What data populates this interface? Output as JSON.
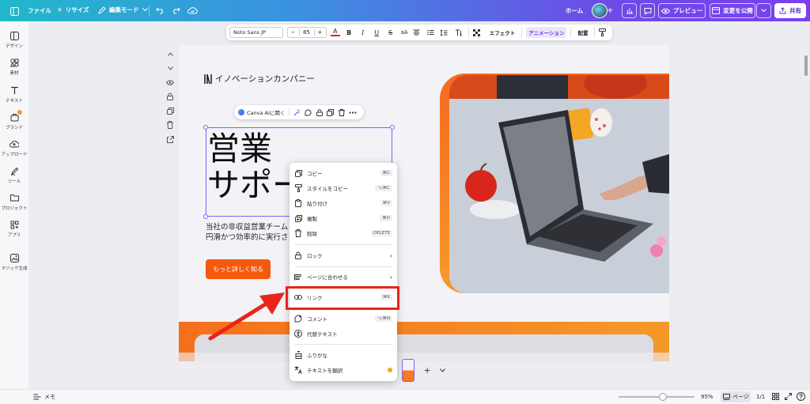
{
  "topbar": {
    "file": "ファイル",
    "resize": "リサイズ",
    "edit_mode": "編集モード",
    "home": "ホーム",
    "preview": "プレビュー",
    "publish": "変更を公開",
    "share": "共有"
  },
  "sidebar": {
    "items": [
      {
        "label": "デザイン",
        "icon": "layout-icon"
      },
      {
        "label": "素材",
        "icon": "elements-icon"
      },
      {
        "label": "テキスト",
        "icon": "text-icon"
      },
      {
        "label": "ブランド",
        "icon": "brand-icon"
      },
      {
        "label": "アップロード",
        "icon": "upload-icon"
      },
      {
        "label": "ツール",
        "icon": "draw-icon"
      },
      {
        "label": "プロジェクト",
        "icon": "folder-icon"
      },
      {
        "label": "アプリ",
        "icon": "apps-icon"
      },
      {
        "label": "マジック生成",
        "icon": "magic-icon"
      }
    ]
  },
  "format_bar": {
    "font": "Noto Sans JP",
    "size": "85",
    "minus": "−",
    "plus": "+",
    "case": "aA",
    "effects": "エフェクト",
    "animate": "アニメーション",
    "position": "配置"
  },
  "canvas": {
    "logo_text": "イノベーションカンパニー",
    "title_line1": "営業",
    "title_line2": "サポート",
    "body_line1": "当社の非収益営業チーム",
    "body_line2": "円滑かつ効率的に実行さ",
    "cta": "もっと詳しく知る"
  },
  "element_toolbar": {
    "canva_ai": "Canva AIに聞く"
  },
  "context_menu": {
    "items": [
      {
        "label": "コピー",
        "shortcut": "⌘C"
      },
      {
        "label": "スタイルをコピー",
        "shortcut": "⌥⌘C"
      },
      {
        "label": "貼り付け",
        "shortcut": "⌘V"
      },
      {
        "label": "複製",
        "shortcut": "⌘D"
      },
      {
        "label": "削除",
        "shortcut": "DELETE"
      },
      {
        "label": "ロック",
        "arrow": "›"
      },
      {
        "label": "ページに合わせる",
        "arrow": "›"
      },
      {
        "label": "リンク",
        "shortcut": "⌘K"
      },
      {
        "label": "コメント",
        "shortcut": "⌥⌘N"
      },
      {
        "label": "代替テキスト"
      },
      {
        "label": "ふりがな"
      },
      {
        "label": "テキストを翻訳"
      }
    ]
  },
  "bottombar": {
    "notes": "メモ",
    "zoom": "95%",
    "pages": "ページ",
    "page_count": "1/1"
  },
  "colors": {
    "accent": "#7b3ff0",
    "cta": "#f5590e",
    "highlight": "#e8241c",
    "selection": "#8b5cf6"
  }
}
